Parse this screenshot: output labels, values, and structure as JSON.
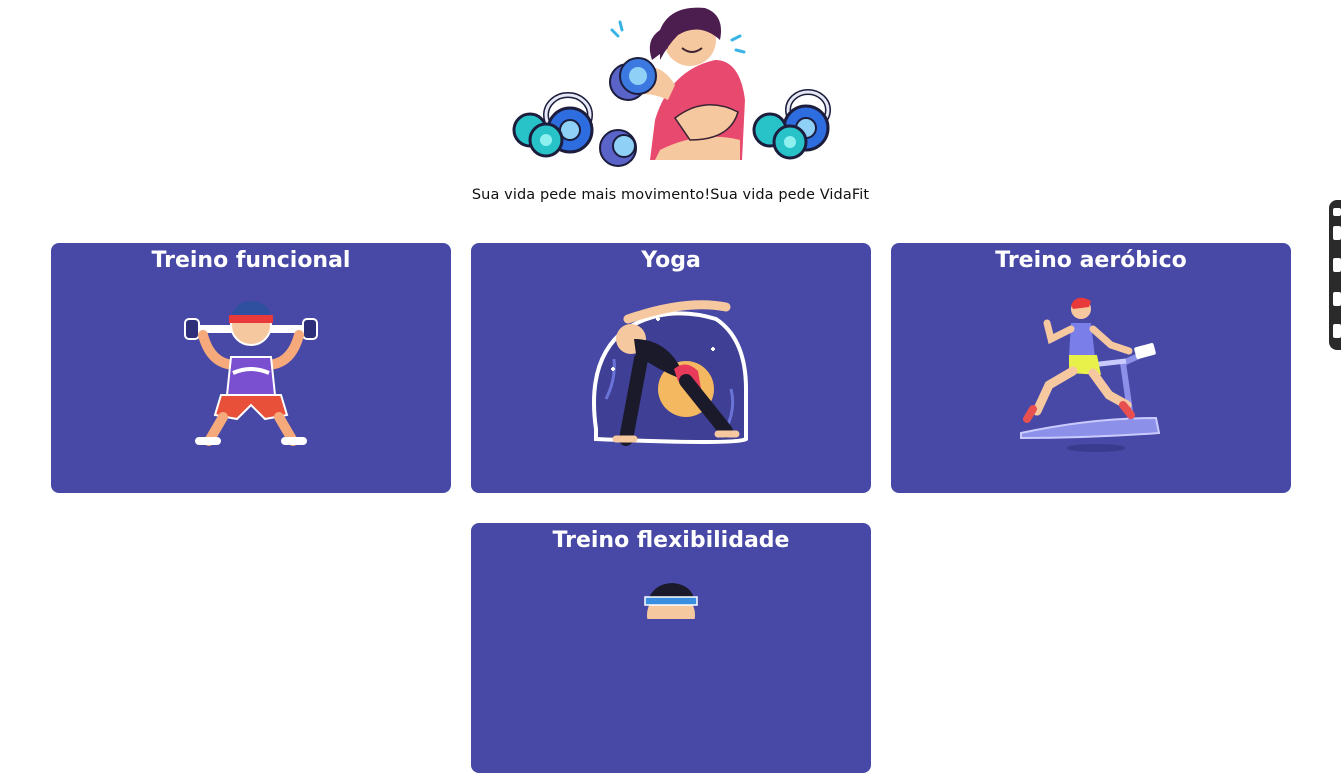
{
  "tagline": "Sua vida pede mais movimento!Sua vida pede VidaFit",
  "cards": [
    {
      "title": "Treino funcional"
    },
    {
      "title": "Yoga"
    },
    {
      "title": "Treino aeróbico"
    },
    {
      "title": "Treino flexibilidade"
    }
  ],
  "colors": {
    "card_bg": "#4849a6",
    "card_title": "#ffffff"
  }
}
